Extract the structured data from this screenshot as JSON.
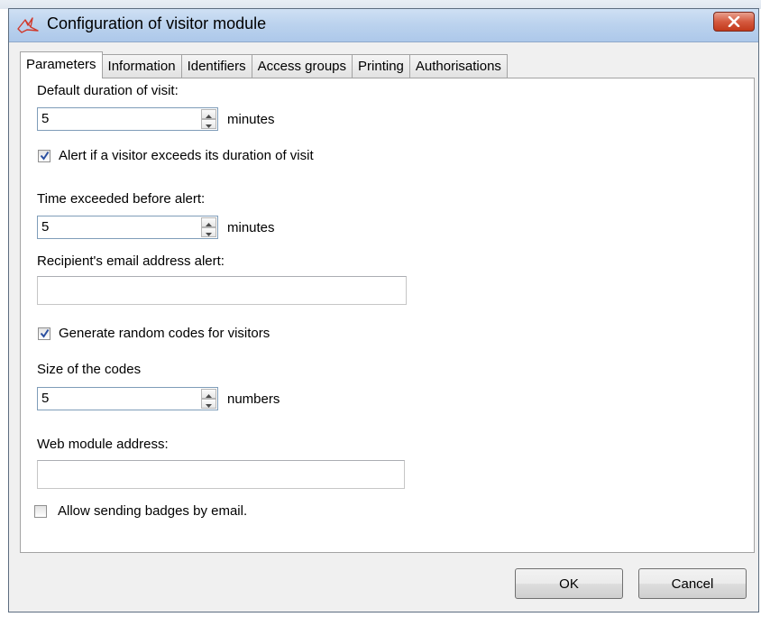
{
  "window": {
    "title": "Configuration of visitor module"
  },
  "tabs": [
    {
      "label": "Parameters",
      "active": true
    },
    {
      "label": "Information"
    },
    {
      "label": "Identifiers"
    },
    {
      "label": "Access groups"
    },
    {
      "label": "Printing"
    },
    {
      "label": "Authorisations"
    }
  ],
  "params": {
    "duration_label": "Default duration of visit:",
    "duration_value": "5",
    "duration_unit": "minutes",
    "alert_checkbox_label": "Alert if a visitor exceeds its duration of visit",
    "alert_checked": true,
    "exceeded_label": "Time exceeded before alert:",
    "exceeded_value": "5",
    "exceeded_unit": "minutes",
    "email_label": "Recipient's email address alert:",
    "email_value": "",
    "random_codes_label": "Generate random codes for visitors",
    "random_codes_checked": true,
    "code_size_label": "Size of the codes",
    "code_size_value": "5",
    "code_size_unit": "numbers",
    "web_address_label": "Web module address:",
    "web_address_value": "",
    "badges_email_label": "Allow sending badges by email.",
    "badges_email_checked": false
  },
  "buttons": {
    "ok": "OK",
    "cancel": "Cancel"
  },
  "colors": {
    "titlebar": "#bcd3ee",
    "close_button": "#c2391b",
    "dialog_background": "#f0f0f0"
  }
}
